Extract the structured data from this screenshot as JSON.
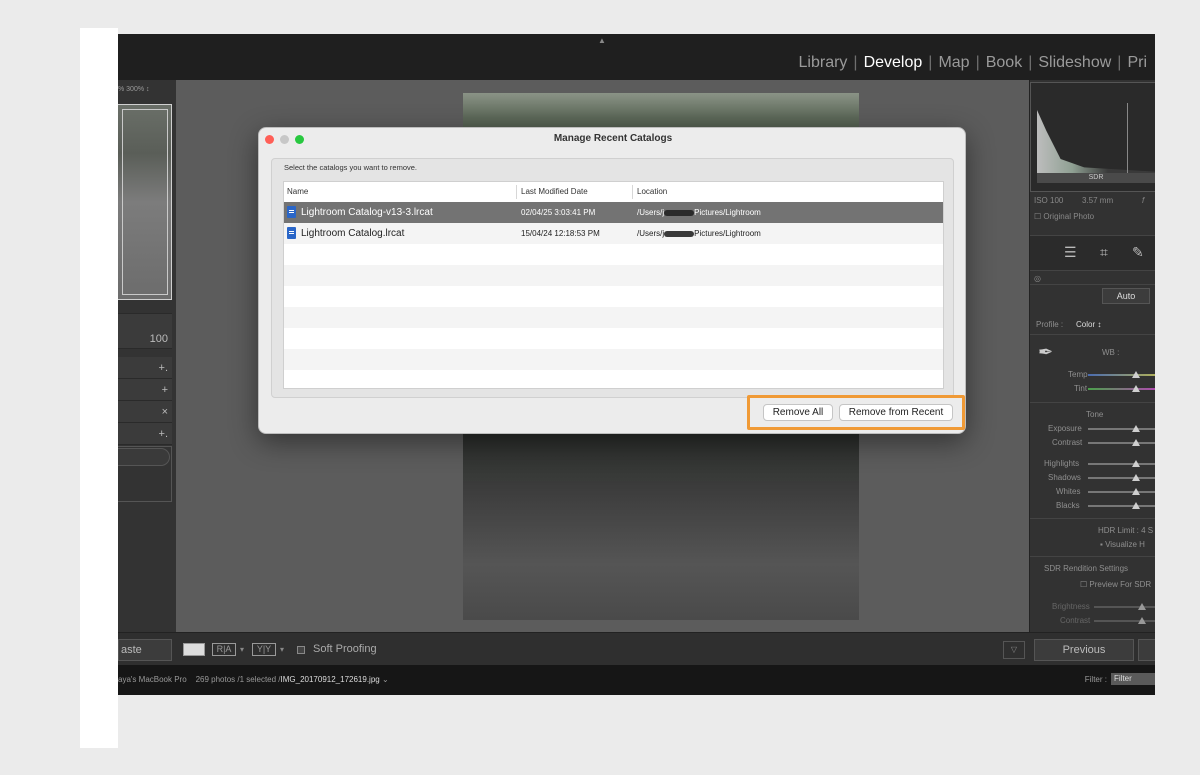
{
  "modules": {
    "items": [
      "Library",
      "Develop",
      "Map",
      "Book",
      "Slideshow",
      "Pri"
    ],
    "active_index": 1
  },
  "left_panel": {
    "zoom_text": "% 300% ↕",
    "value_100": "100",
    "row_icons": [
      "+.",
      "+",
      "×",
      "+."
    ]
  },
  "right_panel": {
    "histogram_label": "SDR",
    "meta_iso": "ISO 100",
    "meta_focal": "3.57 mm",
    "meta_f": "f",
    "original_photo": "Original Photo",
    "auto_label": "Auto",
    "profile_label": "Profile :",
    "profile_value": "Color ↕",
    "wb_label": "WB :",
    "temp_label": "Temp",
    "tint_label": "Tint",
    "tone_label": "Tone",
    "exposure_label": "Exposure",
    "contrast_label": "Contrast",
    "highlights_label": "Highlights",
    "shadows_label": "Shadows",
    "whites_label": "Whites",
    "blacks_label": "Blacks",
    "hdr_limit": "HDR Limit :  4 S",
    "visualize": "Visualize H",
    "sdr_rendition": "SDR Rendition Settings",
    "preview_for_sdr": "Preview For SDR",
    "brightness_label": "Brightness",
    "contrast2_label": "Contrast"
  },
  "bottom_toolbar": {
    "paste_label": "aste",
    "view_ra": "R|A",
    "view_yy": "Y|Y",
    "soft_proofing": "Soft Proofing",
    "previous_label": "Previous"
  },
  "filmstrip": {
    "device": "aya's MacBook Pro",
    "photos_info": "269 photos /1 selected /",
    "selected_file": "IMG_20170912_172619.jpg",
    "dropdown_glyph": "⌄",
    "filter_label": "Filter :",
    "filter_value": "Filter"
  },
  "dialog": {
    "title": "Manage Recent Catalogs",
    "instruction": "Select the catalogs you want to remove.",
    "columns": [
      "Name",
      "Last Modified Date",
      "Location"
    ],
    "rows": [
      {
        "name": "Lightroom Catalog-v13-3.lrcat",
        "modified": "02/04/25 3:03:41 PM",
        "location_prefix": "/Users/j",
        "location_suffix": "Pictures/Lightroom",
        "selected": true
      },
      {
        "name": "Lightroom Catalog.lrcat",
        "modified": "15/04/24 12:18:53 PM",
        "location_prefix": "/Users/j",
        "location_suffix": "Pictures/Lightroom",
        "selected": false
      }
    ],
    "empty_rows": 7,
    "remove_all_label": "Remove All",
    "remove_from_recent_label": "Remove from Recent"
  },
  "colors": {
    "highlight_box": "#f09a36",
    "traffic_red": "#ff5f57",
    "traffic_gray": "#c7c7c7",
    "traffic_green": "#28c840",
    "selected_row": "#737373",
    "catalog_icon": "#2a66c8"
  },
  "icons": {
    "window_close": "close-traffic-light",
    "window_min": "minimize-traffic-light",
    "window_zoom": "zoom-traffic-light",
    "catalog_file": "catalog-file-icon",
    "eyedropper": "eyedropper-icon"
  }
}
